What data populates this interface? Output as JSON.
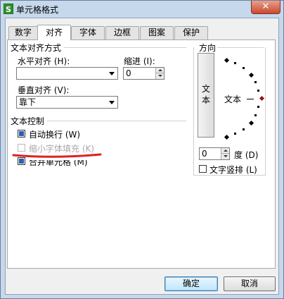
{
  "window": {
    "title": "单元格格式",
    "app_icon": "S",
    "close_label": "✕"
  },
  "tabs": [
    {
      "label": "数字",
      "active": false
    },
    {
      "label": "对齐",
      "active": true
    },
    {
      "label": "字体",
      "active": false
    },
    {
      "label": "边框",
      "active": false
    },
    {
      "label": "图案",
      "active": false
    },
    {
      "label": "保护",
      "active": false
    }
  ],
  "alignment": {
    "section_title": "文本对齐方式",
    "horizontal_label": "水平对齐 (H):",
    "horizontal_value": "",
    "indent_label": "缩进 (I):",
    "indent_value": "0",
    "vertical_label": "垂直对齐 (V):",
    "vertical_value": "靠下"
  },
  "text_control": {
    "section_title": "文本控制",
    "wrap_text": {
      "label": "自动换行 (W)",
      "checked": true
    },
    "shrink_to_fit": {
      "label": "缩小字体填充 (K)",
      "disabled": true
    },
    "merge_cells": {
      "label": "合并单元格 (M)",
      "checked": true
    }
  },
  "orientation": {
    "title": "方向",
    "vertical_text": [
      "文",
      "本"
    ],
    "preview_text": "文本",
    "degrees_value": "0",
    "degrees_label": "度 (D)",
    "vertical_stack_label": "文字竖排 (L)"
  },
  "buttons": {
    "ok": "确定",
    "cancel": "取消"
  },
  "annotation_color": "#e02020"
}
